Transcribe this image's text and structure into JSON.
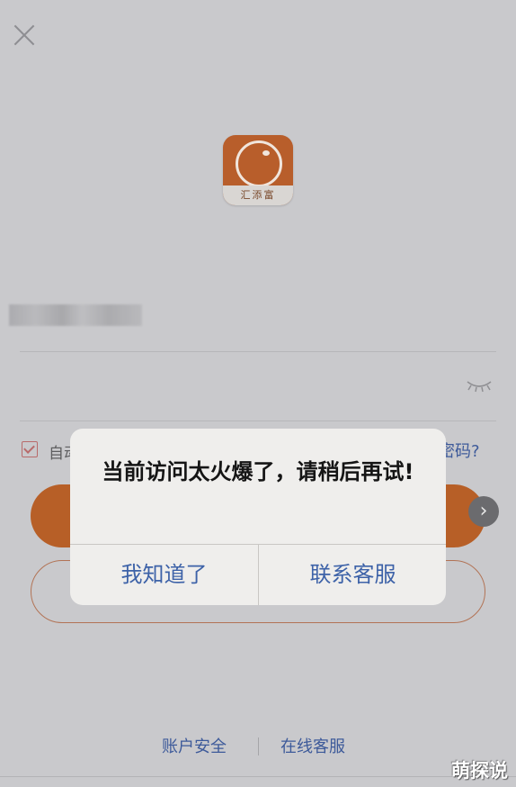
{
  "app": {
    "logo_text": "汇添富"
  },
  "login": {
    "remember_label": "自动",
    "forgot_password": "记密码?"
  },
  "alert": {
    "message": "当前访问太火爆了，请稍后再试!",
    "ok_button": "我知道了",
    "contact_button": "联系客服"
  },
  "footer": {
    "account_security": "账户安全",
    "online_service": "在线客服"
  },
  "watermark": "萌探说",
  "icons": {
    "close": "close-icon",
    "eye": "eye-closed-icon",
    "checkbox": "checkbox-checked-icon",
    "next": "chevron-right-icon"
  },
  "colors": {
    "brand": "#b75f27",
    "link": "#3d5a9a",
    "alert_button": "#3d62a8"
  }
}
